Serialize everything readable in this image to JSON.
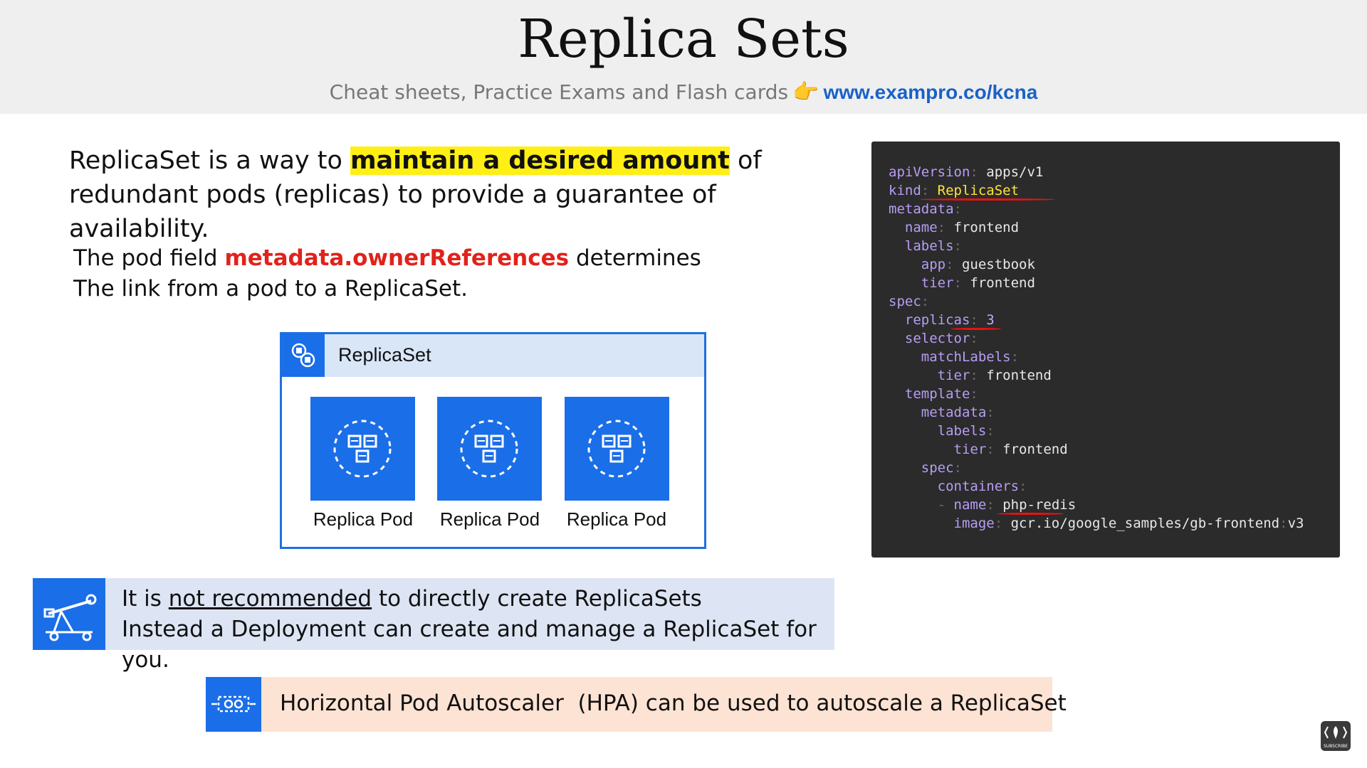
{
  "header": {
    "title": "Replica Sets",
    "subtitle": "Cheat sheets, Practice Exams and Flash cards",
    "link": "www.exampro.co/kcna",
    "pointing_emoji": "👉"
  },
  "intro": {
    "before": "ReplicaSet is a way to ",
    "highlight": "maintain a desired amount",
    "after": " of redundant pods (replicas) to provide a guarantee of availability."
  },
  "owner": {
    "before": "The pod field ",
    "field": "metadata.ownerReferences",
    "after": " determines",
    "line2": "The link from a pod to a ReplicaSet."
  },
  "diagram": {
    "header_label": "ReplicaSet",
    "pods": [
      {
        "label": "Replica Pod"
      },
      {
        "label": "Replica Pod"
      },
      {
        "label": "Replica Pod"
      }
    ]
  },
  "code": {
    "apiVersion": {
      "key": "apiVersion",
      "value": "apps/v1"
    },
    "kind": {
      "key": "kind",
      "value": "ReplicaSet"
    },
    "metadata": "metadata",
    "name": {
      "key": "name",
      "value": "frontend"
    },
    "labels": "labels",
    "app": {
      "key": "app",
      "value": "guestbook"
    },
    "tier1": {
      "key": "tier",
      "value": "frontend"
    },
    "spec": "spec",
    "replicas": {
      "key": "replicas",
      "value": "3"
    },
    "selector": "selector",
    "matchLabels": "matchLabels",
    "tier2": {
      "key": "tier",
      "value": "frontend"
    },
    "template": "template",
    "metadata2": "metadata",
    "labels2": "labels",
    "tier3": {
      "key": "tier",
      "value": "frontend"
    },
    "spec2": "spec",
    "containers": "containers",
    "dash": "-",
    "cname": {
      "key": "name",
      "value": "php-redis"
    },
    "image": {
      "key": "image",
      "value": "gcr.io/google_samples/gb-frontend",
      "tag": "v3"
    }
  },
  "note1": {
    "before": "It is ",
    "underlined": "not recommended",
    "after": " to directly create ReplicaSets",
    "line2": "Instead a Deployment can create and manage a ReplicaSet for you."
  },
  "note2": {
    "text": "Horizontal Pod Autoscaler  (HPA) can be used to autoscale a ReplicaSet"
  },
  "corner": {
    "label": "SUBSCRIBE"
  },
  "colors": {
    "accent_blue": "#1a6ee8",
    "highlight_yellow": "#ffef14",
    "field_red": "#e0231b",
    "code_bg": "#2b2b2b"
  }
}
